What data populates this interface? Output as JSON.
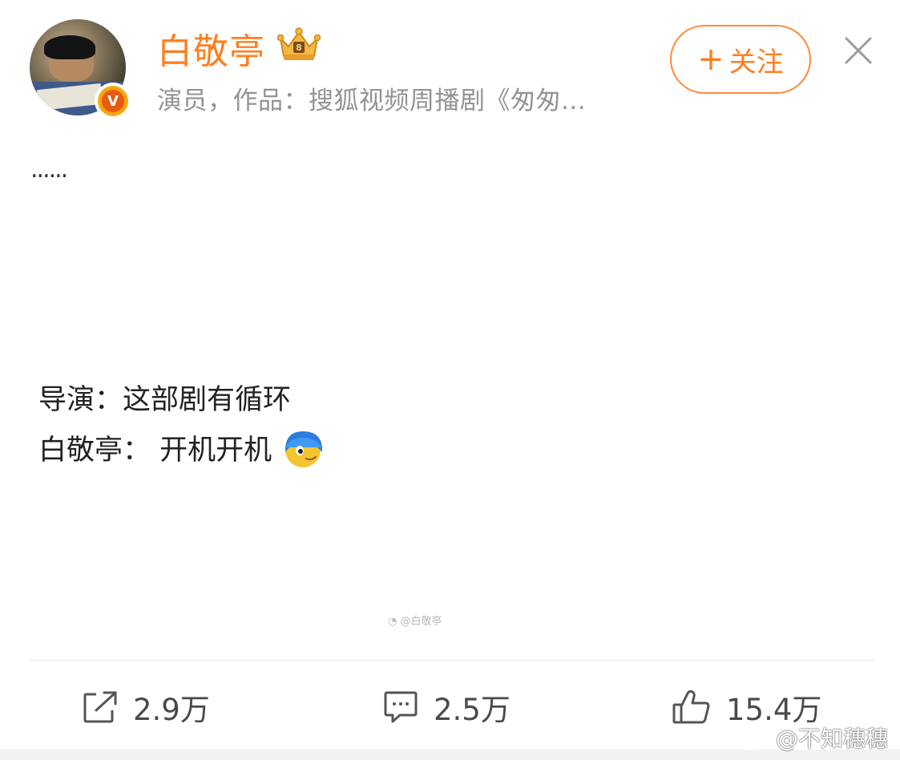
{
  "header": {
    "name": "白敬亭",
    "bio": "演员，作品：搜狐视频周播剧《匆匆...",
    "follow_plus": "+",
    "follow_label": "关注",
    "verified_badge": "V",
    "accent_color": "#ff7e1f"
  },
  "post": {
    "ellipsis": "......",
    "line1": "导演：这部剧有循环",
    "line2": "白敬亭：  开机开机",
    "watermark": "@白敬亭"
  },
  "actions": {
    "repost_count": "2.9万",
    "comment_count": "2.5万",
    "like_count": "15.4万"
  },
  "credit": "@不知穗穗"
}
